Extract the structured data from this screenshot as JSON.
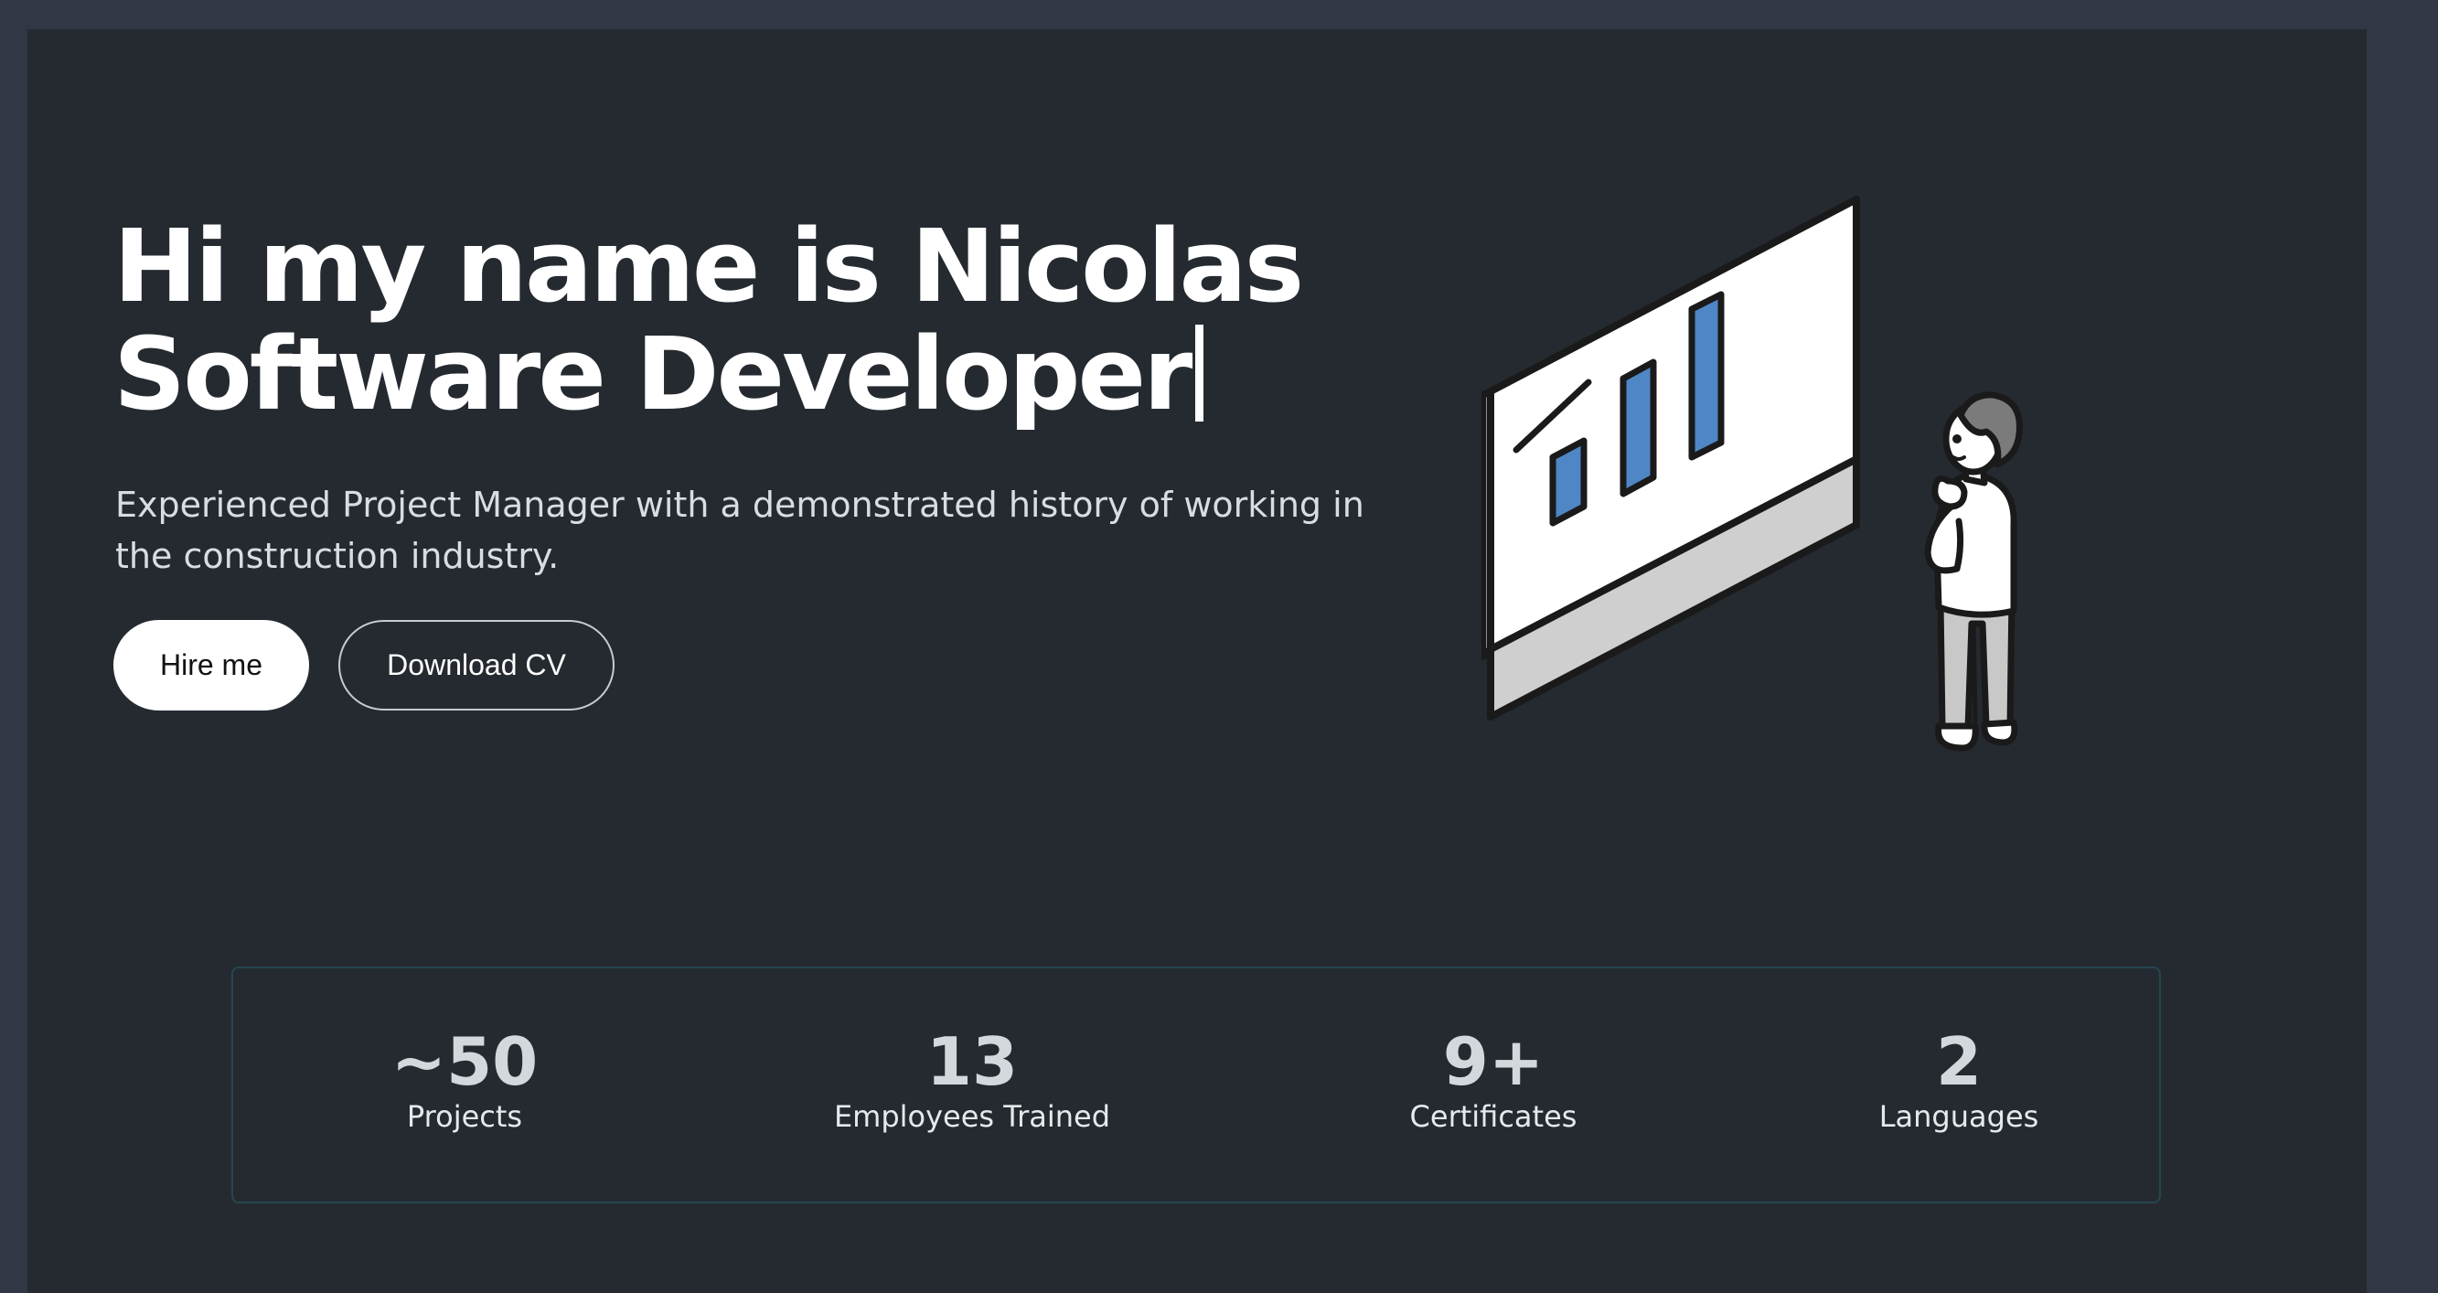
{
  "hero": {
    "title_line1": "Hi my name is Nicolas",
    "title_line2": "Software Developer",
    "subtitle": "Experienced Project Manager with a demonstrated history of working in the construction industry."
  },
  "buttons": {
    "hire": "Hire me",
    "download_cv": "Download CV"
  },
  "illustration": {
    "icon": "person-looking-at-chart-monitor-illustration",
    "colors": {
      "bars": "#4f86c6",
      "outline": "#1a1a1a",
      "screen": "#ffffff",
      "bezel": "#cfcfcf",
      "hair": "#7b7b7b",
      "pants": "#c8c8c8"
    }
  },
  "stats": [
    {
      "value": "~50",
      "label": "Projects"
    },
    {
      "value": "13",
      "label": "Employees Trained"
    },
    {
      "value": "9+",
      "label": "Certificates"
    },
    {
      "value": "2",
      "label": "Languages"
    }
  ],
  "colors": {
    "page_bg": "#313744",
    "panel_bg": "#252a31",
    "stats_border": "#26464f",
    "text_primary": "#ffffff"
  }
}
